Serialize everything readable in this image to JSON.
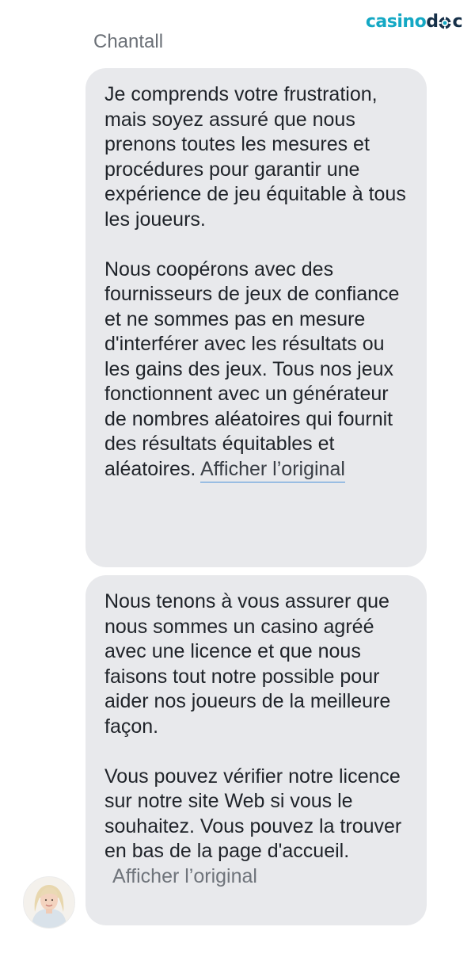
{
  "brand": {
    "logo_part1": "casino",
    "logo_part2": "d",
    "logo_part3": "c"
  },
  "sender": {
    "name": "Chantall"
  },
  "messages": [
    {
      "paragraphs": [
        "Je comprends votre frustration, mais soyez assuré que nous prenons toutes les mesures et procédures pour garantir une expérience de jeu équitable à tous les joueurs.",
        "Nous coopérons avec des fournisseurs de jeux de confiance et ne sommes pas en mesure d'interférer avec les résultats ou les gains des jeux. Tous nos jeux fonctionnent avec un générateur de nombres aléatoires qui fournit des résultats équitables et aléatoires."
      ],
      "show_original_label": "Afficher l’original"
    },
    {
      "paragraphs": [
        "Nous tenons à vous assurer que nous sommes un casino agréé avec une licence et que nous faisons tout notre possible pour aider nos joueurs de la meilleure façon.",
        "Vous pouvez vérifier notre licence sur notre site Web si vous le souhaitez. Vous pouvez la trouver en bas de la page d'accueil."
      ],
      "show_original_label": "Afficher l’original"
    }
  ],
  "colors": {
    "bubble": "#e8e9ec",
    "logo_accent": "#14a8c4",
    "logo_dark": "#163049",
    "link_underline": "#4a90d9"
  }
}
